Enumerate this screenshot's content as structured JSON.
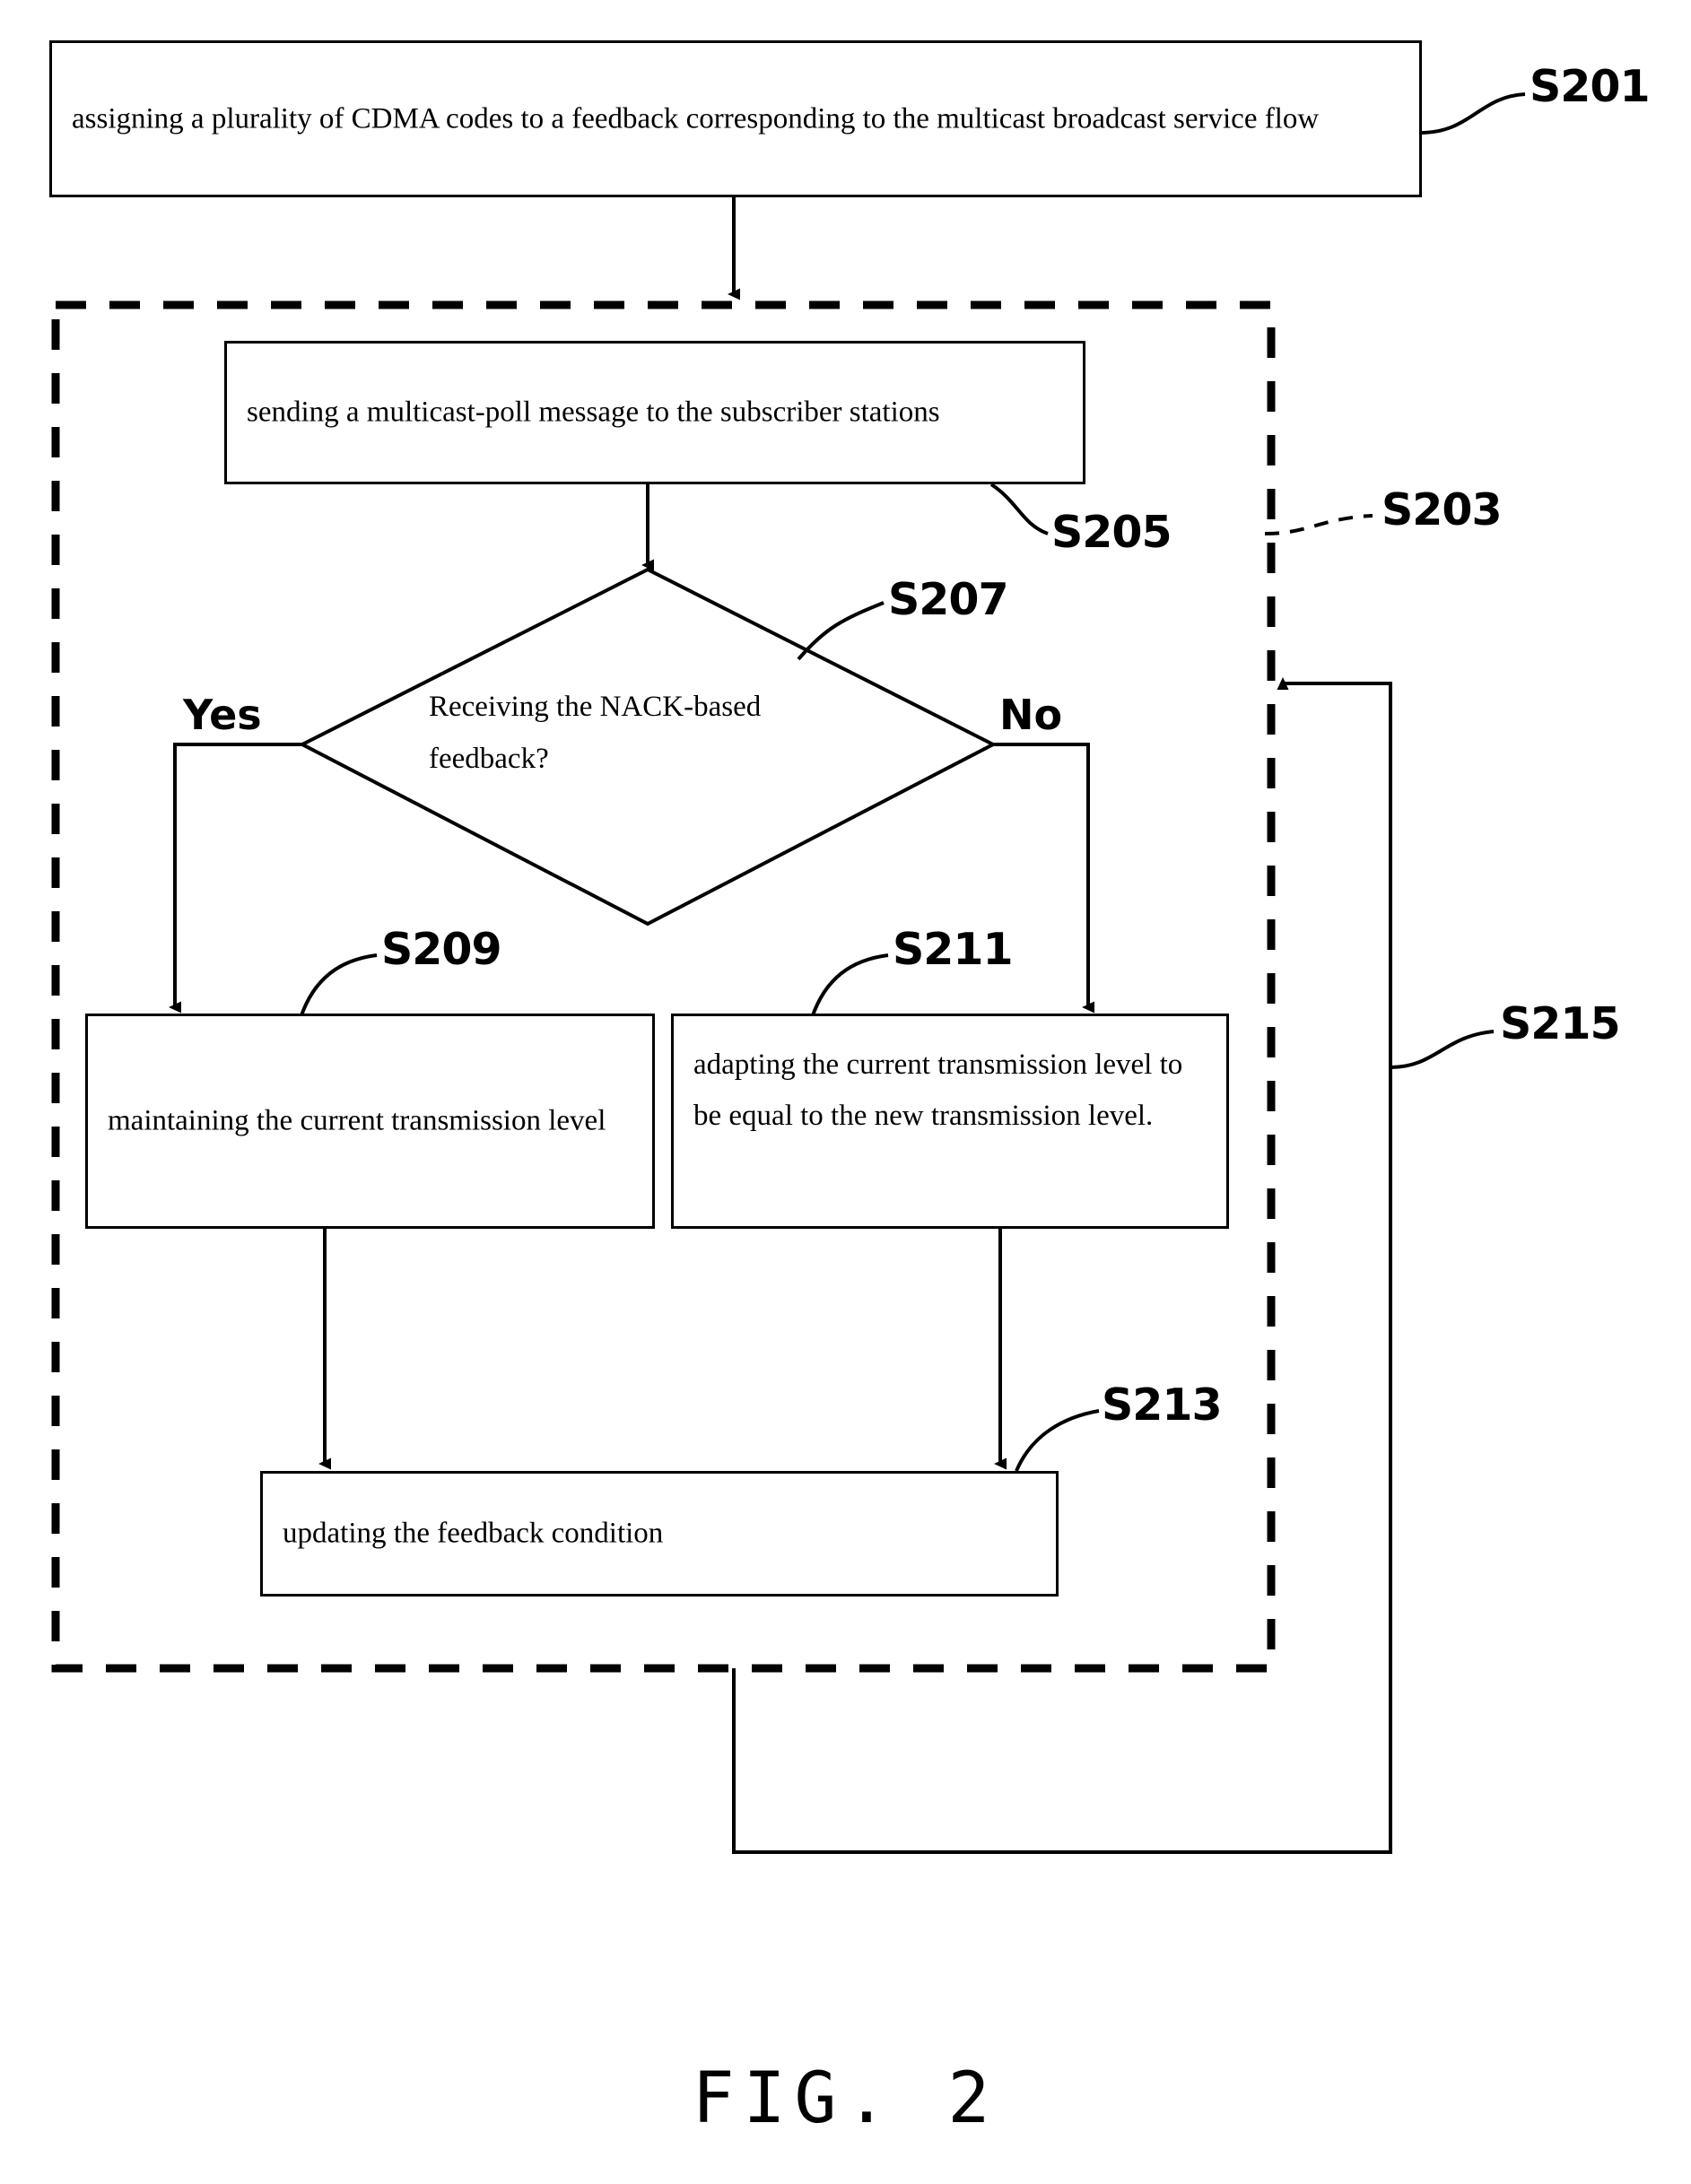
{
  "figure": {
    "caption": "FIG. 2",
    "type": "patent-flowchart"
  },
  "nodes": {
    "s201": {
      "ref": "S201",
      "text": "assigning a plurality of CDMA codes to a feedback corresponding to the multicast broadcast service flow",
      "shape": "process"
    },
    "s203": {
      "ref": "S203",
      "text": "",
      "shape": "dashed-group"
    },
    "s205": {
      "ref": "S205",
      "text": "sending a multicast-poll message to the subscriber stations",
      "shape": "process"
    },
    "s207": {
      "ref": "S207",
      "text_line1": "Receiving the NACK-based",
      "text_line2": "feedback?",
      "shape": "decision",
      "branch_yes": "Yes",
      "branch_no": "No"
    },
    "s209": {
      "ref": "S209",
      "text": "maintaining the current transmission level",
      "shape": "process"
    },
    "s211": {
      "ref": "S211",
      "text": "adapting the current transmission level to be equal to the new transmission level.",
      "shape": "process"
    },
    "s213": {
      "ref": "S213",
      "text": "updating the feedback condition",
      "shape": "process"
    },
    "s215": {
      "ref": "S215",
      "text": "",
      "shape": "loop-back"
    }
  },
  "colors": {
    "stroke": "#000000",
    "background": "#ffffff"
  }
}
